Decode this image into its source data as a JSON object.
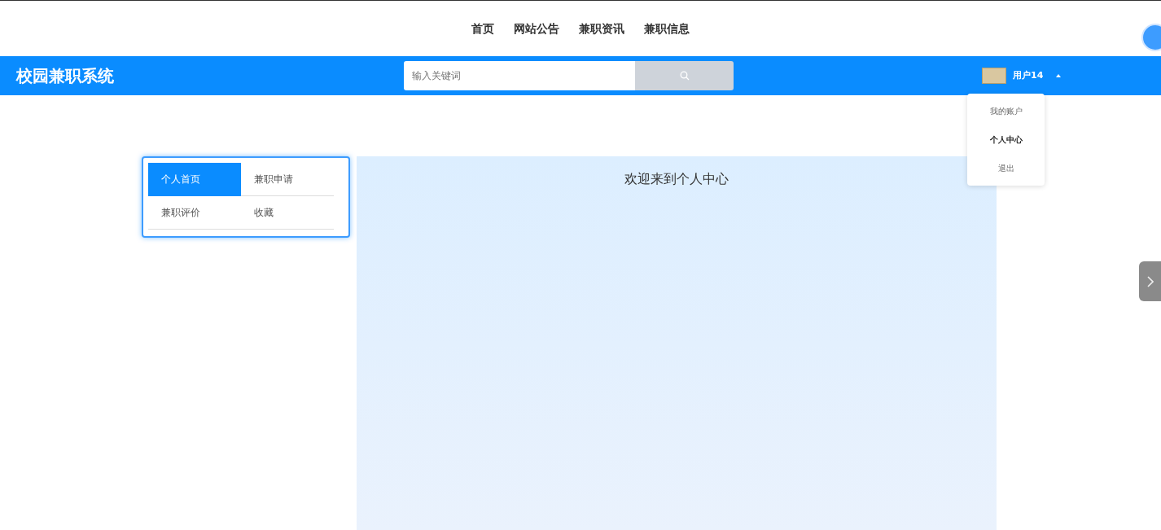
{
  "top_nav": {
    "items": [
      {
        "label": "首页"
      },
      {
        "label": "网站公告"
      },
      {
        "label": "兼职资讯"
      },
      {
        "label": "兼职信息"
      }
    ]
  },
  "header": {
    "title": "校园兼职系统",
    "search": {
      "placeholder": "输入关键词"
    },
    "user": {
      "name": "用户14",
      "expanded": true
    }
  },
  "user_menu": {
    "items": [
      {
        "label": "我的账户",
        "selected": false
      },
      {
        "label": "个人中心",
        "selected": true
      },
      {
        "label": "退出",
        "selected": false
      }
    ]
  },
  "side_menu": {
    "items": [
      {
        "label": "个人首页",
        "selected": true
      },
      {
        "label": "兼职申请",
        "selected": false
      },
      {
        "label": "兼职评价",
        "selected": false
      },
      {
        "label": "收藏",
        "selected": false
      }
    ]
  },
  "content": {
    "title": "欢迎来到个人中心"
  }
}
